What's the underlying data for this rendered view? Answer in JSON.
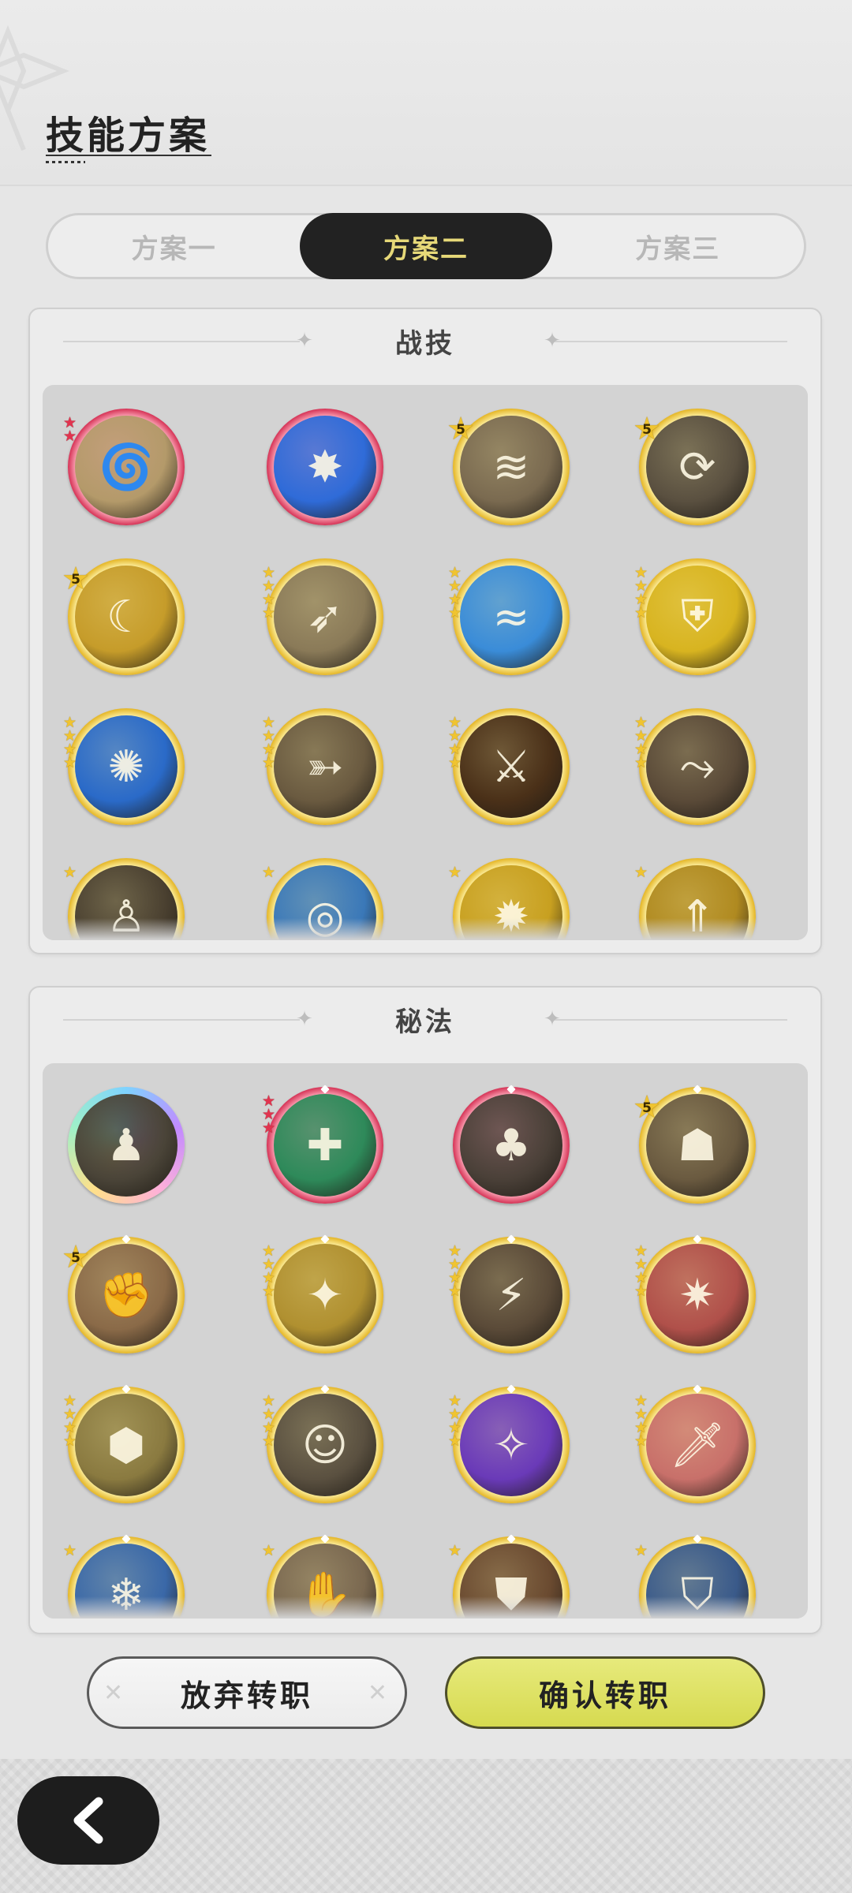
{
  "title": "技能方案",
  "tabs": [
    {
      "label": "方案一",
      "active": false
    },
    {
      "label": "方案二",
      "active": true
    },
    {
      "label": "方案三",
      "active": false
    }
  ],
  "combat_section": {
    "title": "战技",
    "icons": [
      {
        "frame": "red",
        "badge": "stars",
        "count": 2,
        "art": "swirl",
        "color": "#b49a6a"
      },
      {
        "frame": "red",
        "badge": "none",
        "art": "slash",
        "color": "#2f6bd8"
      },
      {
        "frame": "gold",
        "badge": "five",
        "count": 5,
        "art": "wind",
        "color": "#7a6a50"
      },
      {
        "frame": "gold",
        "badge": "five",
        "count": 5,
        "art": "spin",
        "color": "#5a5040"
      },
      {
        "frame": "gold",
        "badge": "five",
        "count": 5,
        "art": "crescent",
        "color": "#c69c2a"
      },
      {
        "frame": "gold",
        "badge": "stars",
        "count": 4,
        "art": "blade",
        "color": "#8a7a58"
      },
      {
        "frame": "gold",
        "badge": "stars",
        "count": 4,
        "art": "wave",
        "color": "#3a8cd8"
      },
      {
        "frame": "gold",
        "badge": "stars",
        "count": 4,
        "art": "shield",
        "color": "#d8b420"
      },
      {
        "frame": "gold",
        "badge": "stars",
        "count": 4,
        "art": "vortex",
        "color": "#2a6ac8"
      },
      {
        "frame": "gold",
        "badge": "stars",
        "count": 4,
        "art": "dash",
        "color": "#6a5a40"
      },
      {
        "frame": "gold",
        "badge": "stars",
        "count": 4,
        "art": "swords",
        "color": "#4a3018"
      },
      {
        "frame": "gold",
        "badge": "stars",
        "count": 4,
        "art": "slash-arc",
        "color": "#5a4a38"
      },
      {
        "frame": "gold",
        "badge": "stars",
        "count": 1,
        "art": "figure",
        "color": "#4a4030"
      },
      {
        "frame": "gold",
        "badge": "stars",
        "count": 1,
        "art": "ripple",
        "color": "#3a78b8"
      },
      {
        "frame": "gold",
        "badge": "stars",
        "count": 1,
        "art": "burst",
        "color": "#c8a020"
      },
      {
        "frame": "gold",
        "badge": "stars",
        "count": 1,
        "art": "rise",
        "color": "#b08a20"
      }
    ]
  },
  "secret_section": {
    "title": "秘法",
    "icons": [
      {
        "frame": "rainbow",
        "badge": "none",
        "art": "group",
        "color": "#4a4438"
      },
      {
        "frame": "red",
        "badge": "stars",
        "count": 3,
        "art": "heal",
        "color": "#2e8a5a"
      },
      {
        "frame": "red",
        "badge": "none",
        "art": "tree",
        "color": "#4a4038"
      },
      {
        "frame": "gold",
        "badge": "five",
        "count": 5,
        "art": "guard",
        "color": "#6a5a40"
      },
      {
        "frame": "gold",
        "badge": "five",
        "count": 5,
        "art": "might",
        "color": "#8a6a48"
      },
      {
        "frame": "gold",
        "badge": "stars",
        "count": 4,
        "art": "blessing",
        "color": "#b09030"
      },
      {
        "frame": "gold",
        "badge": "stars",
        "count": 4,
        "art": "strike",
        "color": "#5a4a38"
      },
      {
        "frame": "gold",
        "badge": "stars",
        "count": 4,
        "art": "rage",
        "color": "#b0504a"
      },
      {
        "frame": "gold",
        "badge": "stars",
        "count": 4,
        "art": "hex",
        "color": "#8a7a40"
      },
      {
        "frame": "gold",
        "badge": "stars",
        "count": 4,
        "art": "portrait",
        "color": "#5a5040"
      },
      {
        "frame": "gold",
        "badge": "stars",
        "count": 4,
        "art": "arcane",
        "color": "#6a3ab8"
      },
      {
        "frame": "gold",
        "badge": "stars",
        "count": 4,
        "art": "sword",
        "color": "#c8706a"
      },
      {
        "frame": "gold",
        "badge": "stars",
        "count": 1,
        "art": "ice",
        "color": "#3a68a8"
      },
      {
        "frame": "gold",
        "badge": "stars",
        "count": 1,
        "art": "fist",
        "color": "#7a6850"
      },
      {
        "frame": "gold",
        "badge": "stars",
        "count": 1,
        "art": "emblem",
        "color": "#6a4a30"
      },
      {
        "frame": "gold",
        "badge": "stars",
        "count": 1,
        "art": "ward",
        "color": "#3a5a8a"
      }
    ]
  },
  "buttons": {
    "abandon": "放弃转职",
    "confirm": "确认转职"
  },
  "colors": {
    "accent_yellow": "#d6da50",
    "active_tab_bg": "#222222",
    "active_tab_text": "#e6d878"
  }
}
